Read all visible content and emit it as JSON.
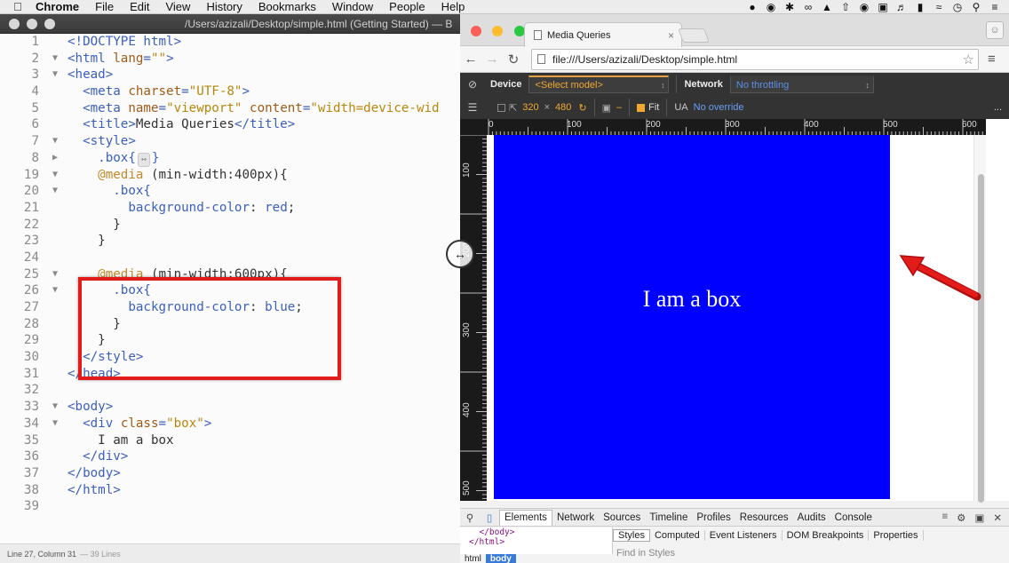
{
  "menubar": {
    "app": "Chrome",
    "items": [
      "File",
      "Edit",
      "View",
      "History",
      "Bookmarks",
      "Window",
      "People",
      "Help"
    ],
    "status_icons": [
      "evernote-icon",
      "tag-icon",
      "settings-icon",
      "creative-cloud-icon",
      "bell-icon",
      "upload-icon",
      "record-icon",
      "adobe-icon",
      "volume-icon",
      "battery-icon",
      "wifi-icon",
      "clock-icon",
      "search-icon",
      "list-icon"
    ]
  },
  "editor": {
    "title": "/Users/azizali/Desktop/simple.html (Getting Started) — B",
    "status_position": "Line 27, Column 31",
    "status_lines": "— 39 Lines",
    "lines": [
      {
        "n": "1",
        "fold": "",
        "segs": [
          [
            "tag",
            "<!DOCTYPE html>"
          ]
        ]
      },
      {
        "n": "2",
        "fold": "▼",
        "segs": [
          [
            "tag",
            "<html "
          ],
          [
            "attr",
            "lang"
          ],
          [
            "tag",
            "="
          ],
          [
            "str",
            "\"\""
          ],
          [
            "tag",
            ">"
          ]
        ]
      },
      {
        "n": "3",
        "fold": "▼",
        "segs": [
          [
            "tag",
            "<head>"
          ]
        ]
      },
      {
        "n": "4",
        "fold": "",
        "segs": [
          [
            "txt",
            "  "
          ],
          [
            "tag",
            "<meta "
          ],
          [
            "attr",
            "charset"
          ],
          [
            "tag",
            "="
          ],
          [
            "str",
            "\"UTF-8\""
          ],
          [
            "tag",
            ">"
          ]
        ]
      },
      {
        "n": "5",
        "fold": "",
        "segs": [
          [
            "txt",
            "  "
          ],
          [
            "tag",
            "<meta "
          ],
          [
            "attr",
            "name"
          ],
          [
            "tag",
            "="
          ],
          [
            "str",
            "\"viewport\""
          ],
          [
            "txt",
            " "
          ],
          [
            "attr",
            "content"
          ],
          [
            "tag",
            "="
          ],
          [
            "str",
            "\"width=device-wid"
          ]
        ]
      },
      {
        "n": "6",
        "fold": "",
        "segs": [
          [
            "txt",
            "  "
          ],
          [
            "tag",
            "<title>"
          ],
          [
            "txt",
            "Media Queries"
          ],
          [
            "tag",
            "</title>"
          ]
        ]
      },
      {
        "n": "7",
        "fold": "▼",
        "segs": [
          [
            "txt",
            "  "
          ],
          [
            "tag",
            "<style>"
          ]
        ]
      },
      {
        "n": "8",
        "fold": "▶",
        "segs": [
          [
            "txt",
            "    "
          ],
          [
            "cls",
            ".box{"
          ],
          [
            "fbox",
            "↔"
          ],
          [
            "cls",
            "}"
          ]
        ]
      },
      {
        "n": "19",
        "fold": "▼",
        "segs": [
          [
            "txt",
            "    "
          ],
          [
            "at",
            "@media"
          ],
          [
            "txt",
            " (min-width:"
          ],
          [
            "txt",
            "400px"
          ],
          [
            "txt",
            "){"
          ]
        ]
      },
      {
        "n": "20",
        "fold": "▼",
        "segs": [
          [
            "txt",
            "      "
          ],
          [
            "cls",
            ".box{"
          ]
        ]
      },
      {
        "n": "21",
        "fold": "",
        "segs": [
          [
            "txt",
            "        "
          ],
          [
            "prop",
            "background-color"
          ],
          [
            "txt",
            ": "
          ],
          [
            "val",
            "red"
          ],
          [
            "txt",
            ";"
          ]
        ]
      },
      {
        "n": "22",
        "fold": "",
        "segs": [
          [
            "txt",
            "      "
          ],
          [
            "txt",
            "}"
          ]
        ]
      },
      {
        "n": "23",
        "fold": "",
        "segs": [
          [
            "txt",
            "    "
          ],
          [
            "txt",
            "}"
          ]
        ]
      },
      {
        "n": "24",
        "fold": "",
        "segs": []
      },
      {
        "n": "25",
        "fold": "▼",
        "segs": [
          [
            "txt",
            "    "
          ],
          [
            "at",
            "@media"
          ],
          [
            "txt",
            " (min-width:"
          ],
          [
            "txt",
            "600px"
          ],
          [
            "txt",
            "){"
          ]
        ]
      },
      {
        "n": "26",
        "fold": "▼",
        "segs": [
          [
            "txt",
            "      "
          ],
          [
            "cls",
            ".box{"
          ]
        ]
      },
      {
        "n": "27",
        "fold": "",
        "segs": [
          [
            "txt",
            "        "
          ],
          [
            "prop",
            "background-color"
          ],
          [
            "txt",
            ": "
          ],
          [
            "val",
            "blue"
          ],
          [
            "txt",
            ";"
          ]
        ]
      },
      {
        "n": "28",
        "fold": "",
        "segs": [
          [
            "txt",
            "      "
          ],
          [
            "txt",
            "}"
          ]
        ]
      },
      {
        "n": "29",
        "fold": "",
        "segs": [
          [
            "txt",
            "    "
          ],
          [
            "txt",
            "}"
          ]
        ]
      },
      {
        "n": "30",
        "fold": "",
        "segs": [
          [
            "txt",
            "  "
          ],
          [
            "tag",
            "</style>"
          ]
        ]
      },
      {
        "n": "31",
        "fold": "",
        "segs": [
          [
            "tag",
            "</head>"
          ]
        ]
      },
      {
        "n": "32",
        "fold": "",
        "segs": []
      },
      {
        "n": "33",
        "fold": "▼",
        "segs": [
          [
            "tag",
            "<body>"
          ]
        ]
      },
      {
        "n": "34",
        "fold": "▼",
        "segs": [
          [
            "txt",
            "  "
          ],
          [
            "tag",
            "<div "
          ],
          [
            "attr",
            "class"
          ],
          [
            "tag",
            "="
          ],
          [
            "str",
            "\"box\""
          ],
          [
            "tag",
            ">"
          ]
        ]
      },
      {
        "n": "35",
        "fold": "",
        "segs": [
          [
            "txt",
            "    I am a box"
          ]
        ]
      },
      {
        "n": "36",
        "fold": "",
        "segs": [
          [
            "txt",
            "  "
          ],
          [
            "tag",
            "</div>"
          ]
        ]
      },
      {
        "n": "37",
        "fold": "",
        "segs": [
          [
            "tag",
            "</body>"
          ]
        ]
      },
      {
        "n": "38",
        "fold": "",
        "segs": [
          [
            "tag",
            "</html>"
          ]
        ]
      },
      {
        "n": "39",
        "fold": "",
        "segs": []
      }
    ]
  },
  "browser": {
    "tab_title": "Media Queries",
    "tab_close": "×",
    "url": "file:///Users/azizali/Desktop/simple.html",
    "device_label": "Device",
    "device_select": "<Select model>",
    "network_label": "Network",
    "network_select": "No throttling",
    "width": "320",
    "times": "×",
    "height": "480",
    "dash": "–",
    "fit_label": "Fit",
    "ua_label": "UA",
    "ua_value": "No override",
    "more": "...",
    "h_ruler": [
      "0",
      "100",
      "200",
      "300",
      "400",
      "500",
      "600"
    ],
    "v_ruler": [
      "100",
      "200",
      "300",
      "400",
      "500"
    ],
    "box_text": "I am a box",
    "page_bg": "#ffffff",
    "box_color": "#0000ff"
  },
  "devtools": {
    "tabs": [
      "Elements",
      "Network",
      "Sources",
      "Timeline",
      "Profiles",
      "Resources",
      "Audits",
      "Console"
    ],
    "dom_lines": [
      "  </body>",
      "</html>"
    ],
    "style_tabs": [
      "Styles",
      "Computed",
      "Event Listeners",
      "DOM Breakpoints",
      "Properties"
    ],
    "find_placeholder": "Find in Styles",
    "crumbs": [
      "html",
      "body"
    ]
  },
  "colors": {
    "highlight_red": "#e21b1b",
    "accent_orange": "#f0a830",
    "accent_blue": "#6a9ef5"
  }
}
